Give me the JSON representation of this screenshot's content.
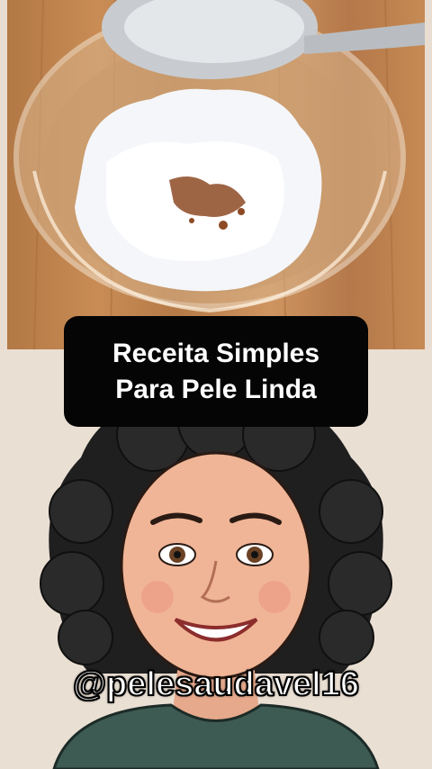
{
  "title": {
    "line1": "Receita Simples",
    "line2": "Para Pele Linda"
  },
  "handle": "@pelesaudavel16",
  "colors": {
    "table_wood": "#c98c55",
    "powder": "#ffffff",
    "title_bg": "#050505",
    "shirt": "#3d5b52",
    "background": "#eadfd3"
  }
}
